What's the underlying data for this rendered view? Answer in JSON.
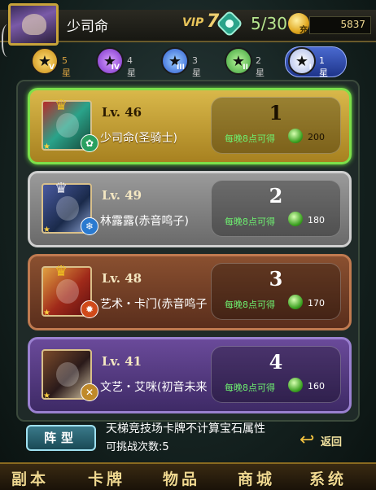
{
  "header": {
    "player_name": "少司命",
    "vip_label": "VIP",
    "vip_level": "7",
    "stamina": "5/30",
    "gold_icon_label": "充",
    "gold": "5837"
  },
  "filters": [
    {
      "label": "5星",
      "roman": "V",
      "icon": "star-5-icon"
    },
    {
      "label": "4星",
      "roman": "IV",
      "icon": "star-4-icon"
    },
    {
      "label": "3星",
      "roman": "III",
      "icon": "star-3-icon"
    },
    {
      "label": "2星",
      "roman": "II",
      "icon": "star-2-icon"
    },
    {
      "label": "1星",
      "roman": "I",
      "icon": "star-1-icon",
      "selected": true
    }
  ],
  "ranking": [
    {
      "level": "Lv. 46",
      "name": "少司命(圣骑士)",
      "rank": "1",
      "nightly": "每晚8点可得",
      "reward": "200"
    },
    {
      "level": "Lv. 49",
      "name": "林露露(赤音鸣子)",
      "rank": "2",
      "nightly": "每晚8点可得",
      "reward": "180"
    },
    {
      "level": "Lv. 48",
      "name": "艺术・卡门(赤音鸣子",
      "rank": "3",
      "nightly": "每晚8点可得",
      "reward": "170"
    },
    {
      "level": "Lv. 41",
      "name": "文艺・艾咪(初音未来",
      "rank": "4",
      "nightly": "每晚8点可得",
      "reward": "160"
    }
  ],
  "footer": {
    "formation_label": "阵型",
    "info_line1": "天梯竞技场卡牌不计算宝石属性",
    "info_line2": "可挑战次数:5",
    "back_label": "返回"
  },
  "nav": [
    "副本",
    "卡牌",
    "物品",
    "商城",
    "系统"
  ]
}
